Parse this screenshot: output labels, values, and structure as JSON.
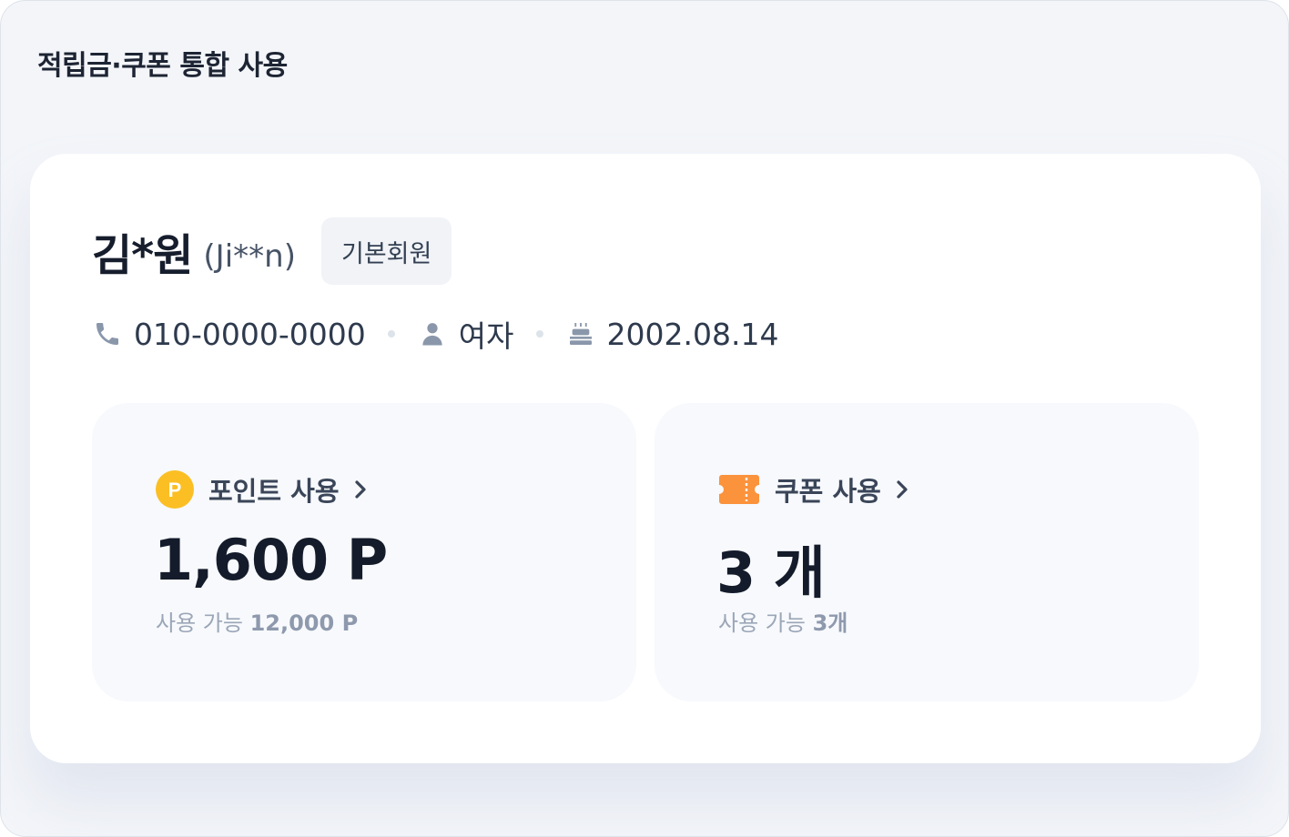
{
  "header": {
    "title": "적립금·쿠폰 통합 사용"
  },
  "member": {
    "name": "김*원",
    "alias": "(Ji**n)",
    "grade": "기본회원",
    "phone": "010-0000-0000",
    "gender": "여자",
    "birthday": "2002.08.14",
    "icons": {
      "phone": "phone-icon",
      "gender": "person-icon",
      "birthday": "cake-icon"
    }
  },
  "points": {
    "icon": "point-coin-icon",
    "icon_letter": "P",
    "label": "포인트 사용",
    "value": "1,600 P",
    "available_label": "사용 가능",
    "available_value": "12,000 P",
    "accent": "#fbbf24"
  },
  "coupons": {
    "icon": "coupon-ticket-icon",
    "label": "쿠폰 사용",
    "value": "3 개",
    "available_label": "사용 가능",
    "available_value": "3개",
    "accent": "#fb923c"
  }
}
